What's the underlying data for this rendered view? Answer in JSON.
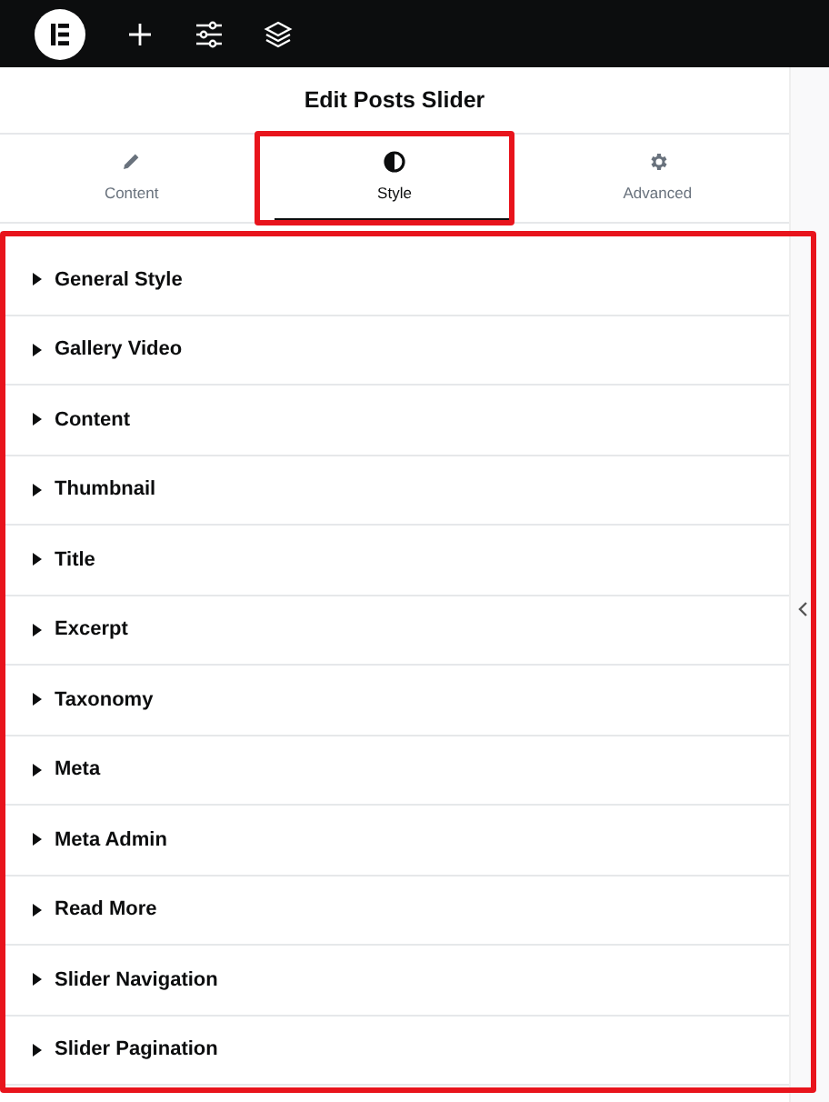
{
  "panel": {
    "title": "Edit Posts Slider"
  },
  "tabs": [
    {
      "label": "Content",
      "kind": "pencil",
      "selected": false
    },
    {
      "label": "Style",
      "kind": "contrast",
      "selected": true
    },
    {
      "label": "Advanced",
      "kind": "gear",
      "selected": false
    }
  ],
  "sections": [
    {
      "label": "General Style",
      "expanded": false
    },
    {
      "label": "Gallery Video",
      "expanded": false
    },
    {
      "label": "Content",
      "expanded": false
    },
    {
      "label": "Thumbnail",
      "expanded": false
    },
    {
      "label": "Title",
      "expanded": false
    },
    {
      "label": "Excerpt",
      "expanded": false
    },
    {
      "label": "Taxonomy",
      "expanded": false
    },
    {
      "label": "Meta",
      "expanded": false
    },
    {
      "label": "Meta Admin",
      "expanded": false
    },
    {
      "label": "Read More",
      "expanded": false
    },
    {
      "label": "Slider Navigation",
      "expanded": false
    },
    {
      "label": "Slider Pagination",
      "expanded": false
    }
  ]
}
